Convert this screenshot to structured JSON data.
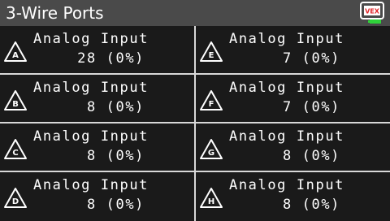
{
  "header": {
    "title": "3-Wire Ports",
    "logo_text": "VEX",
    "battery_color": "#2fd23a"
  },
  "ports": [
    {
      "letter": "A",
      "type": "Analog Input",
      "value": "28 (0%)"
    },
    {
      "letter": "B",
      "type": "Analog Input",
      "value": "8 (0%)"
    },
    {
      "letter": "C",
      "type": "Analog Input",
      "value": "8 (0%)"
    },
    {
      "letter": "D",
      "type": "Analog Input",
      "value": "8 (0%)"
    },
    {
      "letter": "E",
      "type": "Analog Input",
      "value": "7 (0%)"
    },
    {
      "letter": "F",
      "type": "Analog Input",
      "value": "7 (0%)"
    },
    {
      "letter": "G",
      "type": "Analog Input",
      "value": "8 (0%)"
    },
    {
      "letter": "H",
      "type": "Analog Input",
      "value": "8 (0%)"
    }
  ],
  "colors": {
    "background": "#1a1a1a",
    "header": "#4a4a4a",
    "divider": "#d8d8d8",
    "text": "#ffffff",
    "logo_red": "#e0262a"
  }
}
